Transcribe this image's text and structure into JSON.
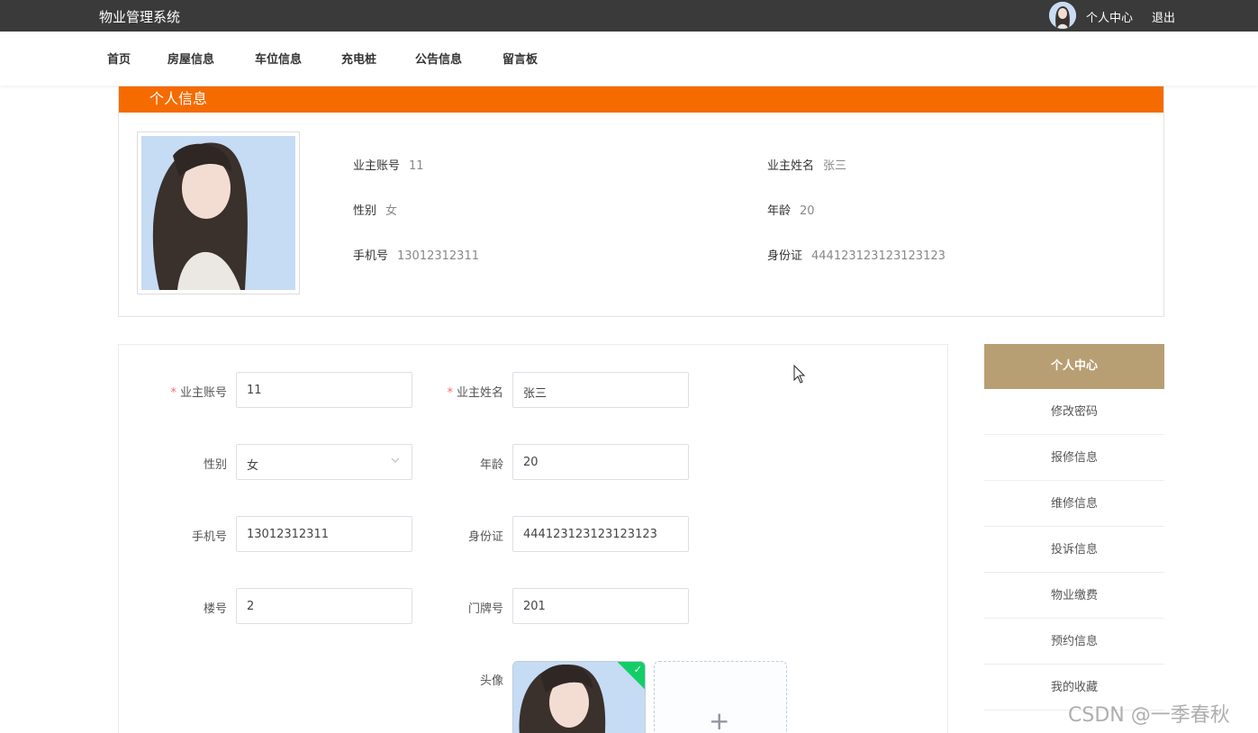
{
  "topbar": {
    "brand": "物业管理系统",
    "user_center": "个人中心",
    "logout": "退出"
  },
  "nav": {
    "items": [
      "首页",
      "房屋信息",
      "车位信息",
      "充电桩",
      "公告信息",
      "留言板"
    ]
  },
  "profile": {
    "header": "个人信息",
    "account_label": "业主账号",
    "account_value": "11",
    "name_label": "业主姓名",
    "name_value": "张三",
    "gender_label": "性别",
    "gender_value": "女",
    "age_label": "年龄",
    "age_value": "20",
    "phone_label": "手机号",
    "phone_value": "13012312311",
    "idcard_label": "身份证",
    "idcard_value": "444123123123123123"
  },
  "form": {
    "account_label": "业主账号",
    "account_value": "11",
    "name_label": "业主姓名",
    "name_value": "张三",
    "gender_label": "性别",
    "gender_value": "女",
    "age_label": "年龄",
    "age_value": "20",
    "phone_label": "手机号",
    "phone_value": "13012312311",
    "idcard_label": "身份证",
    "idcard_value": "444123123123123123",
    "building_label": "楼号",
    "building_value": "2",
    "door_label": "门牌号",
    "door_value": "201",
    "avatar_label": "头像",
    "required_mark": "*",
    "plus": "+"
  },
  "side_menu": {
    "items": [
      "个人中心",
      "修改密码",
      "报修信息",
      "维修信息",
      "投诉信息",
      "物业缴费",
      "预约信息",
      "我的收藏"
    ],
    "active": "个人中心"
  },
  "watermark": "CSDN @一季春秋",
  "colors": {
    "topbar": "#3a3a3a",
    "accent_orange": "#f56b00",
    "side_active": "#b89e73",
    "required": "#f56c6c",
    "upload_success": "#13ce66"
  }
}
